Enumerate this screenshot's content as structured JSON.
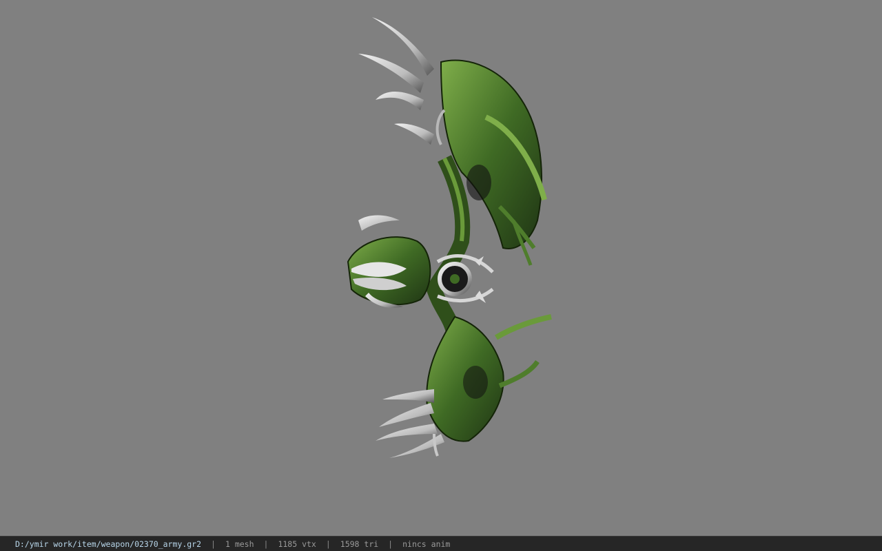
{
  "viewport": {
    "background_color": "#808080",
    "model": {
      "name": "bow-model",
      "colors": {
        "dark_green": "#1f3514",
        "mid_green": "#3f6a24",
        "light_green": "#7fae4a",
        "silver": "#d8d8d8",
        "dark_silver": "#6a6a6a"
      }
    }
  },
  "statusbar": {
    "file_path": "D:/ymir work/item/weapon/02370_army.gr2",
    "mesh_count": "1 mesh",
    "vertex_count": "1185 vtx",
    "triangle_count": "1598 tri",
    "anim_status": "nincs anim",
    "separator": "|"
  }
}
